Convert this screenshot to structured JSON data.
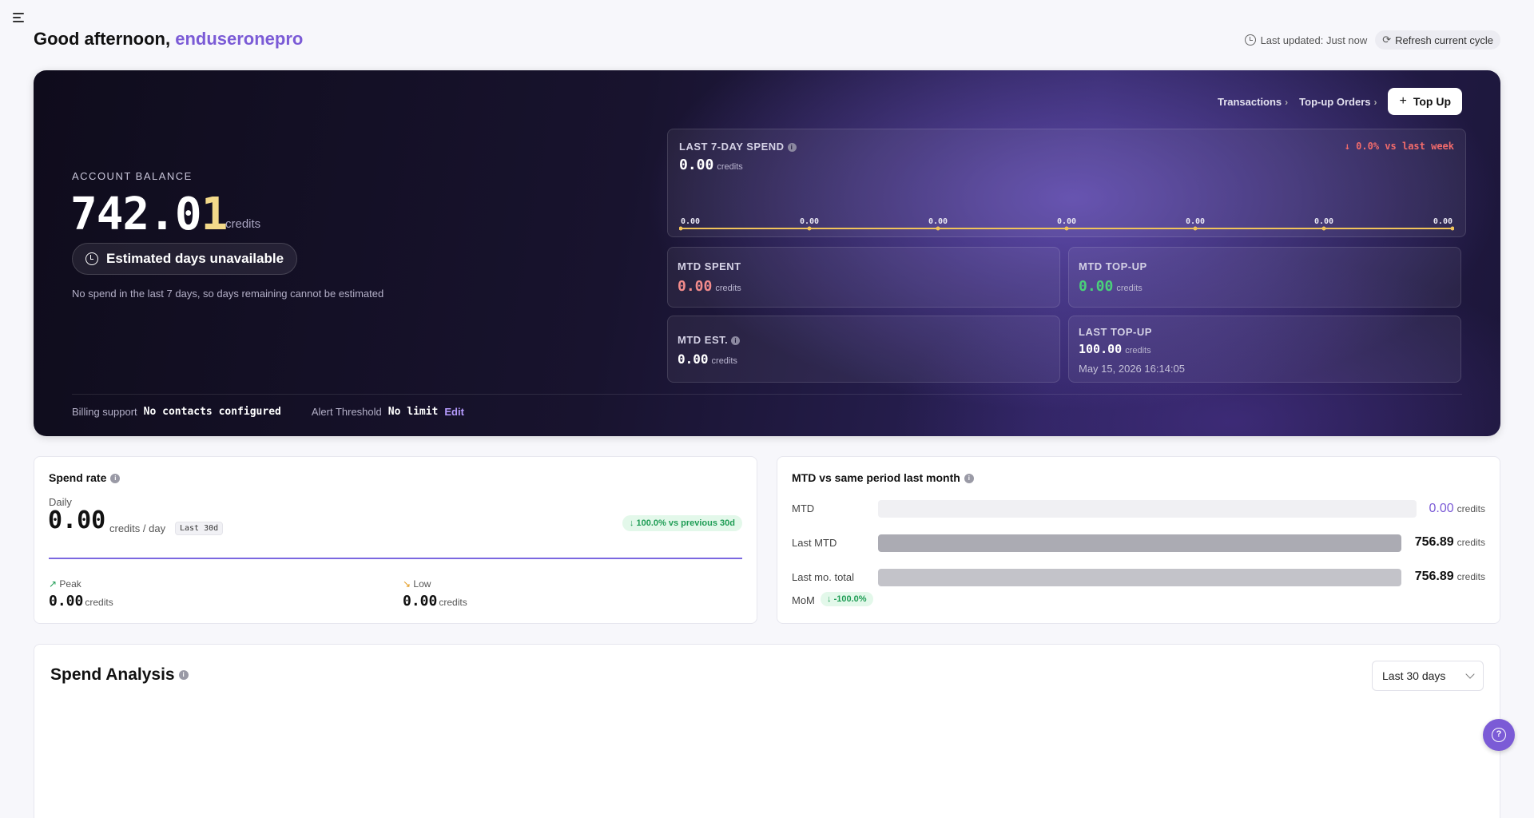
{
  "header": {
    "greeting": "Good afternoon, ",
    "username": "enduseronepro",
    "last_updated": "Last updated: Just now",
    "refresh_label": "Refresh current cycle"
  },
  "hero": {
    "balance_label": "ACCOUNT BALANCE",
    "balance_main": "742.0",
    "balance_last": "1",
    "balance_unit": "credits",
    "est_days": "Estimated days unavailable",
    "est_note": "No spend in the last 7 days, so days remaining cannot be estimated",
    "links": {
      "transactions": "Transactions",
      "topup_orders": "Top-up Orders",
      "topup_button": "Top Up"
    },
    "spend7": {
      "label": "LAST 7-DAY SPEND",
      "value": "0.00",
      "unit": "credits",
      "trend": "↓ 0.0% vs last week",
      "points": [
        "0.00",
        "0.00",
        "0.00",
        "0.00",
        "0.00",
        "0.00",
        "0.00"
      ]
    },
    "mtd_spent": {
      "label": "MTD SPENT",
      "value": "0.00",
      "unit": "credits"
    },
    "mtd_topup": {
      "label": "MTD TOP-UP",
      "value": "0.00",
      "unit": "credits"
    },
    "mtd_est": {
      "label": "MTD EST.",
      "value": "0.00",
      "unit": "credits"
    },
    "last_topup": {
      "label": "LAST TOP-UP",
      "value": "100.00",
      "unit": "credits",
      "timestamp": "May 15, 2026 16:14:05"
    },
    "footer": {
      "billing_label": "Billing support",
      "billing_value": "No contacts configured",
      "alert_label": "Alert Threshold",
      "alert_value": "No limit",
      "edit": "Edit"
    }
  },
  "spend_rate": {
    "title": "Spend rate",
    "daily_label": "Daily",
    "value": "0.00",
    "unit": "credits / day",
    "window": "Last 30d",
    "change": "100.0% vs previous 30d",
    "peak_label": "Peak",
    "peak_value": "0.00",
    "low_label": "Low",
    "low_value": "0.00",
    "unit_short": "credits"
  },
  "mtd_compare": {
    "title": "MTD vs same period last month",
    "rows": [
      {
        "label": "MTD",
        "value": "0.00",
        "unit": "credits",
        "fraction": 0.0
      },
      {
        "label": "Last MTD",
        "value": "756.89",
        "unit": "credits",
        "fraction": 1.0
      },
      {
        "label": "Last mo. total",
        "value": "756.89",
        "unit": "credits",
        "fraction": 1.0
      }
    ],
    "mom_label": "MoM",
    "mom_value": "-100.0%"
  },
  "analysis": {
    "title": "Spend Analysis",
    "range": "Last 30 days"
  },
  "colors": {
    "accent": "#7b5bd6",
    "positive": "#1f9d55",
    "negative": "#f26b6b",
    "spark": "#f0c35a"
  }
}
